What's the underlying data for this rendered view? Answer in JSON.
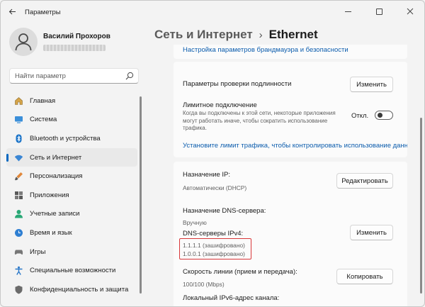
{
  "window": {
    "title": "Параметры"
  },
  "user": {
    "name": "Василий Прохоров"
  },
  "search": {
    "placeholder": "Найти параметр"
  },
  "sidebar": {
    "items": [
      {
        "label": "Главная",
        "icon": "home-icon",
        "active": false
      },
      {
        "label": "Система",
        "icon": "display-icon",
        "active": false
      },
      {
        "label": "Bluetooth и устройства",
        "icon": "bluetooth-icon",
        "active": false
      },
      {
        "label": "Сеть и Интернет",
        "icon": "wifi-icon",
        "active": true
      },
      {
        "label": "Персонализация",
        "icon": "brush-icon",
        "active": false
      },
      {
        "label": "Приложения",
        "icon": "apps-icon",
        "active": false
      },
      {
        "label": "Учетные записи",
        "icon": "person-icon",
        "active": false
      },
      {
        "label": "Время и язык",
        "icon": "globe-clock-icon",
        "active": false
      },
      {
        "label": "Игры",
        "icon": "gamepad-icon",
        "active": false
      },
      {
        "label": "Специальные возможности",
        "icon": "accessibility-icon",
        "active": false
      },
      {
        "label": "Конфиденциальность и защита",
        "icon": "shield-icon",
        "active": false
      }
    ]
  },
  "breadcrumb": {
    "parent": "Сеть и Интернет",
    "separator": "›",
    "current": "Ethernet"
  },
  "main": {
    "firewall_link": "Настройка параметров брандмауэра и безопасности",
    "auth": {
      "label": "Параметры проверки подлинности",
      "button": "Изменить"
    },
    "metered": {
      "label": "Лимитное подключение",
      "description": "Когда вы подключены к этой сети, некоторые приложения могут работать иначе, чтобы сократить использование трафика.",
      "toggle_state": "Откл.",
      "toggle_on": false,
      "limit_link": "Установите лимит трафика, чтобы контролировать использование данных"
    },
    "ip": {
      "label": "Назначение IP:",
      "value": "Автоматически (DHCP)",
      "button": "Редактировать"
    },
    "dns": {
      "label": "Назначение DNS-сервера:",
      "value": "Вручную",
      "servers_label": "DNS-серверы IPv4:",
      "server1": "1.1.1.1 (зашифровано)",
      "server2": "1.0.0.1 (зашифровано)",
      "button": "Изменить"
    },
    "speed": {
      "label": "Скорость линии (прием и передача):",
      "value": "100/100 (Mbps)",
      "button": "Копировать"
    },
    "ipv6": {
      "label": "Локальный IPv6-адрес канала:"
    }
  },
  "colors": {
    "accent": "#0067c0",
    "link": "#0b5cad",
    "highlight": "#d9383a"
  }
}
